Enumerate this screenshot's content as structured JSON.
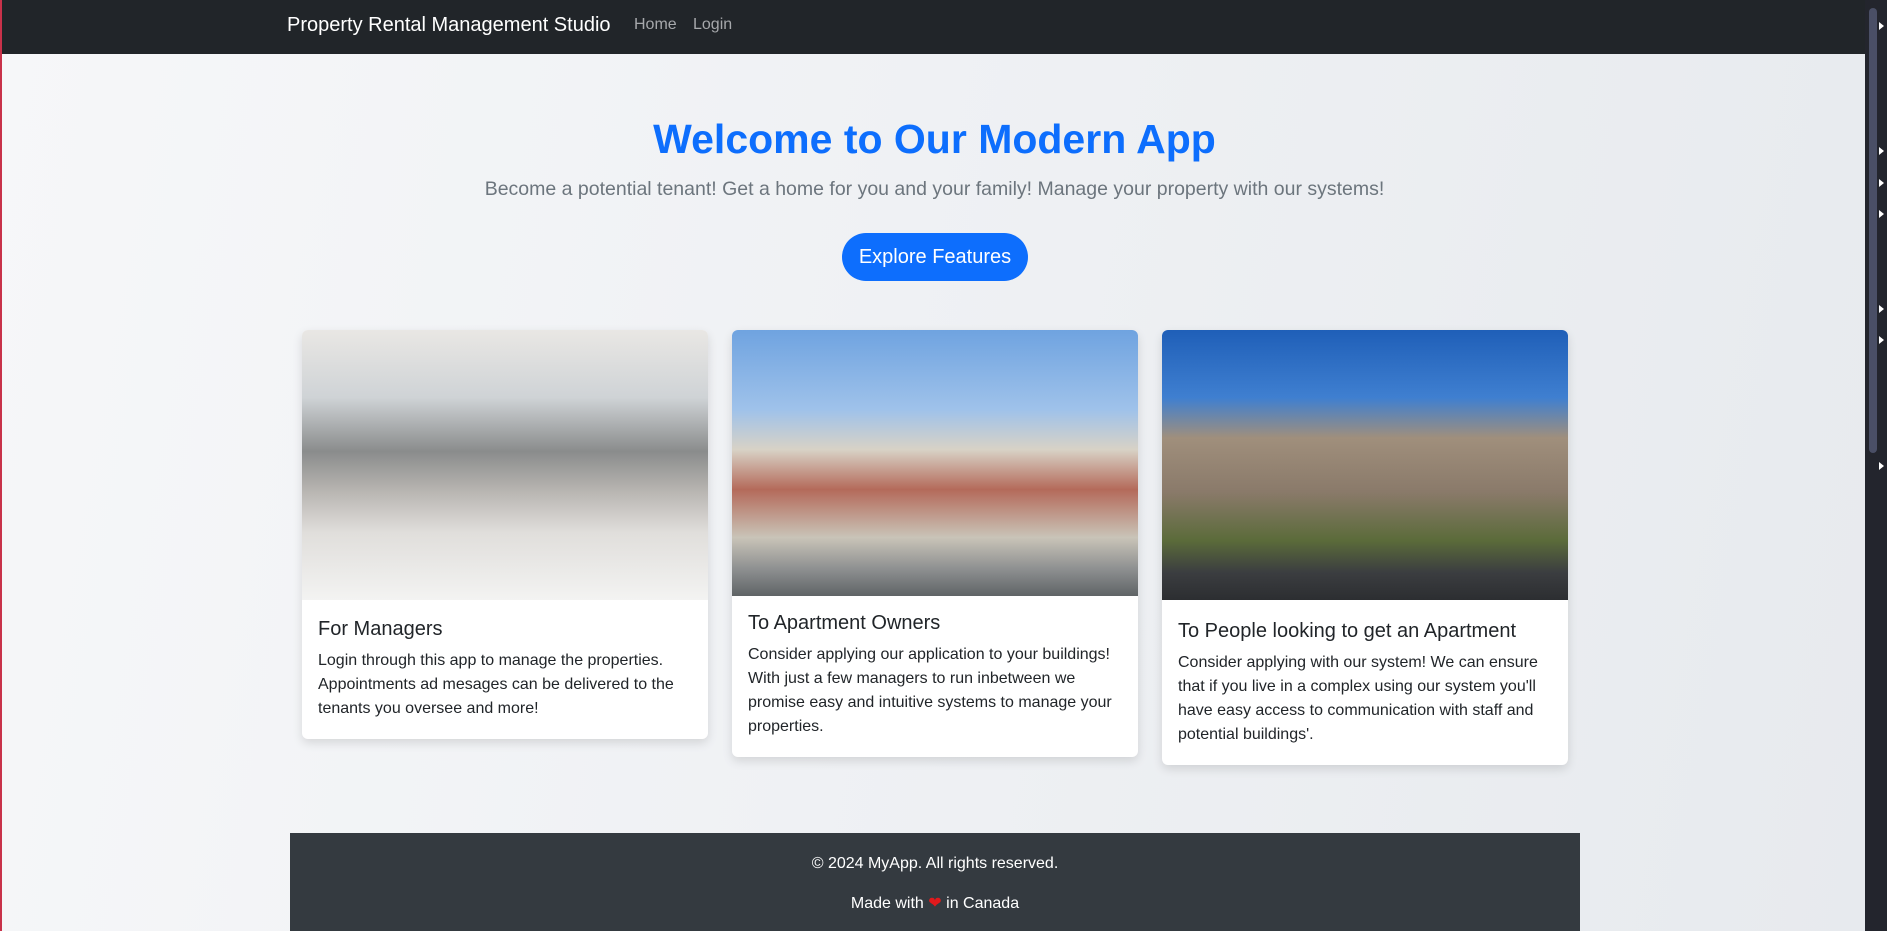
{
  "navbar": {
    "brand": "Property Rental Management Studio",
    "links": [
      "Home",
      "Login"
    ]
  },
  "hero": {
    "title": "Welcome to Our Modern App",
    "subtitle": "Become a potential tenant! Get a home for you and your family! Manage your property with our systems!",
    "button": "Explore Features"
  },
  "cards": [
    {
      "title": "For Managers",
      "text": "Login through this app to manage the properties. Appointments ad mesages can be delivered to the tenants you oversee and more!",
      "image": "modern apartment interior"
    },
    {
      "title": "To Apartment Owners",
      "text": "Consider applying our application to your buildings! With just a few managers to run inbetween we promise easy and intuitive systems to manage your properties.",
      "image": "apartment building exterior"
    },
    {
      "title": "To People looking to get an Apartment",
      "text": "Consider applying with our system! We can ensure that if you live in a complex using our system you'll have easy access to communication with staff and potential buildings'.",
      "image": "apartment complex exterior"
    }
  ],
  "footer": {
    "copyright": "© 2024 MyApp. All rights reserved.",
    "made_prefix": "Made with",
    "made_suffix": "in Canada",
    "heart_icon": "heart-icon"
  },
  "colors": {
    "primary": "#0d6efd",
    "navbar": "#212529",
    "footer": "#343a40"
  }
}
